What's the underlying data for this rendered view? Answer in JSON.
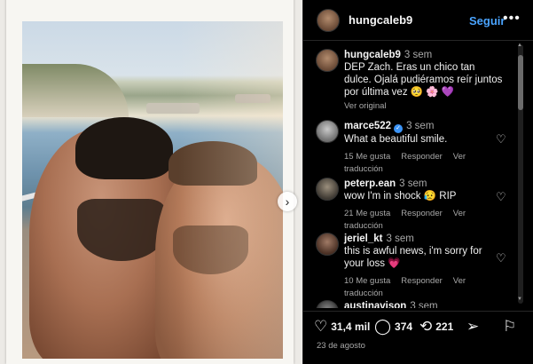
{
  "post": {
    "username": "hungcaleb9",
    "follow_label": "Seguir",
    "more_icon": "•••",
    "next_icon": "›"
  },
  "caption": {
    "username": "hungcaleb9",
    "time": "3 sem",
    "text": "DEP Zach. Eras un chico tan dulce. Ojalá pudiéramos reír juntos por última vez 🥺 🌸 💜",
    "see_original": "Ver original"
  },
  "comments": [
    {
      "username": "marce522",
      "verified": true,
      "time": "3 sem",
      "text": "What a beautiful smile.",
      "likes": "15 Me gusta",
      "reply": "Responder",
      "translate": "Ver traducción"
    },
    {
      "username": "peterp.ean",
      "verified": false,
      "time": "3 sem",
      "text": "wow I'm in shock 😥 RIP",
      "likes": "21 Me gusta",
      "reply": "Responder",
      "translate": "Ver traducción"
    },
    {
      "username": "jeriel_kt",
      "verified": false,
      "time": "3 sem",
      "text": "this is awful news, i'm sorry for your loss 💗",
      "likes": "10 Me gusta",
      "reply": "Responder",
      "translate": "Ver traducción"
    },
    {
      "username": "austinavison",
      "verified": false,
      "time": "3 sem",
      "text": "",
      "likes": "",
      "reply": "",
      "translate": ""
    }
  ],
  "actions": {
    "likes": "31,4 mil",
    "comments": "374",
    "reposts": "221"
  },
  "date": "23 de agosto",
  "icons": {
    "heart": "♡",
    "comment": "◯",
    "repost": "⟲",
    "share": "➢",
    "save": "⚐"
  }
}
